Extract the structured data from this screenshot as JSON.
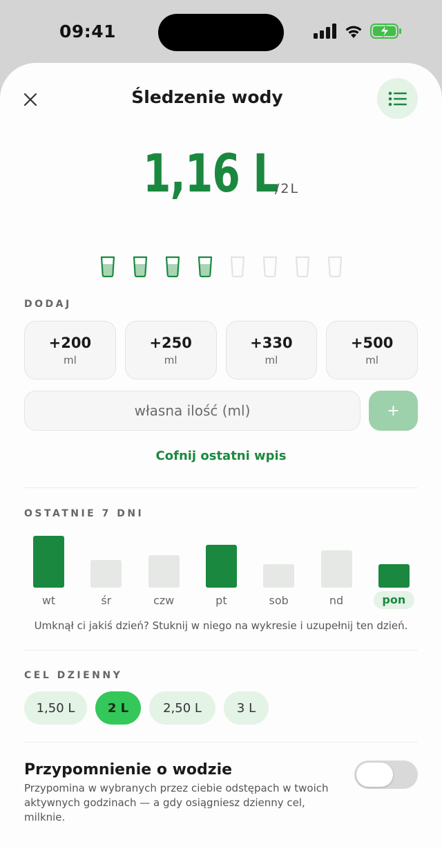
{
  "status": {
    "time": "09:41"
  },
  "header": {
    "title": "Śledzenie wody",
    "close_icon": "close-icon",
    "menu_icon": "list-icon"
  },
  "intake": {
    "amount": "1,16 L",
    "goal": "/2L",
    "cups_total": 8,
    "cups_filled": 4
  },
  "add": {
    "label": "DODAJ",
    "buttons": [
      {
        "amount": "+200",
        "unit": "ml"
      },
      {
        "amount": "+250",
        "unit": "ml"
      },
      {
        "amount": "+330",
        "unit": "ml"
      },
      {
        "amount": "+500",
        "unit": "ml"
      }
    ],
    "custom_placeholder": "własna ilość (ml)",
    "plus_label": "+",
    "undo_label": "Cofnij ostatni wpis"
  },
  "history": {
    "label": "OSTATNIE 7 DNI",
    "hint": "Umknął ci jakiś dzień? Stuknij w niego na wykresie i uzupełnij ten dzień.",
    "chart_data": {
      "type": "bar",
      "categories": [
        "wt",
        "śr",
        "czw",
        "pt",
        "sob",
        "nd",
        "pon"
      ],
      "values": [
        0.75,
        0.4,
        0.47,
        0.62,
        0.34,
        0.54,
        0.34
      ],
      "goal_met": [
        true,
        false,
        false,
        true,
        false,
        false,
        true
      ],
      "active_index": 6,
      "ylim": [
        0,
        1
      ],
      "colors": {
        "met": "#1b8840",
        "unmet": "#e6e8e6"
      }
    }
  },
  "daily_goal": {
    "label": "CEL DZIENNY",
    "options": [
      "1,50 L",
      "2 L",
      "2,50 L",
      "3 L"
    ],
    "selected_index": 1
  },
  "reminder": {
    "title": "Przypomnienie o wodzie",
    "description": "Przypomina w wybranych przez ciebie odstępach w twoich aktywnych godzinach — a gdy osiągniesz dzienny cel, milknie.",
    "enabled": false
  },
  "colors": {
    "accent": "#1b8840",
    "accent_light": "#e3f3e6",
    "selected_pill": "#34c759"
  }
}
